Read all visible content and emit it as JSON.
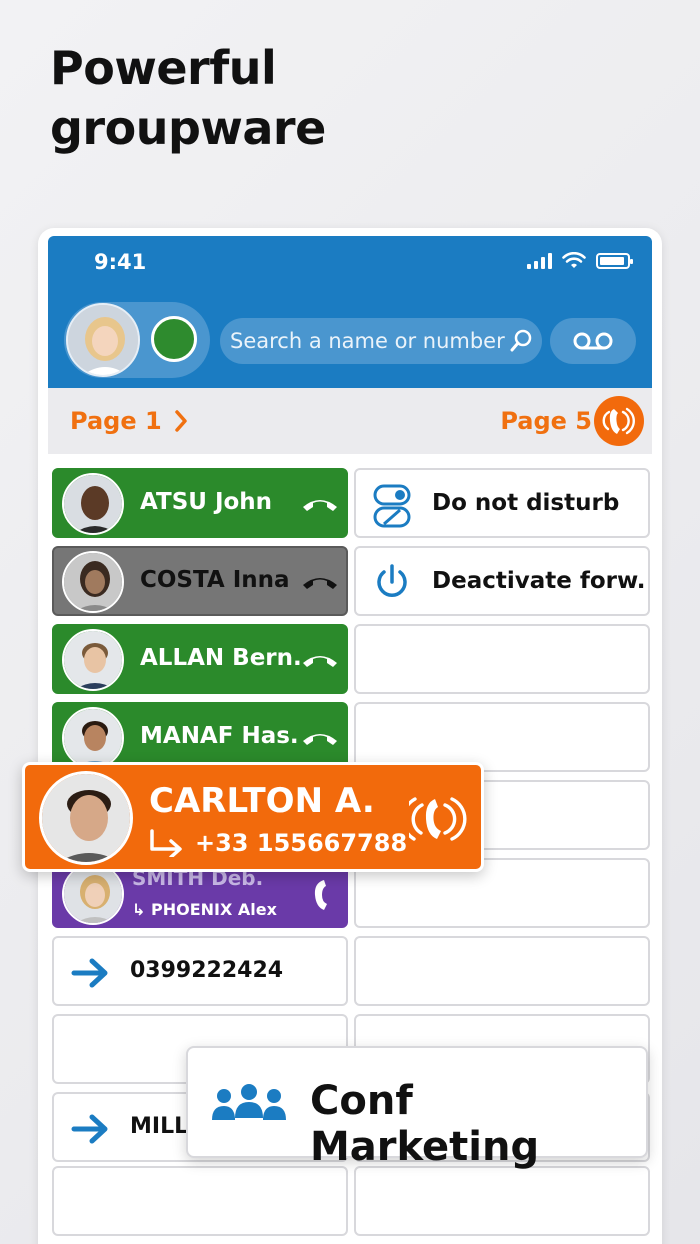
{
  "headline": {
    "line1": "Powerful",
    "line2": "groupware"
  },
  "status_bar": {
    "time": "9:41"
  },
  "header": {
    "search_placeholder": "Search a name or number"
  },
  "pages": {
    "left_label": "Page 1",
    "right_label": "Page 5"
  },
  "left_column": [
    {
      "name": "ATSU John",
      "state": "green"
    },
    {
      "name": "COSTA Inna",
      "state": "grey"
    },
    {
      "name": "ALLAN Bern.",
      "state": "green"
    },
    {
      "name": "MANAF Has.",
      "state": "green"
    },
    {
      "name": "SMITH Deb.",
      "forward": "PHOENIX Alex",
      "state": "purple"
    },
    {
      "number": "0399222424"
    },
    {
      "empty": true
    },
    {
      "number": "MILL"
    },
    {
      "empty": true
    }
  ],
  "right_column": [
    {
      "label": "Do not disturb"
    },
    {
      "label": "Deactivate forw."
    }
  ],
  "incoming_call": {
    "name": "CARLTON A.",
    "number": "+33 155667788"
  },
  "conference": {
    "label": "Conf Marketing"
  },
  "colors": {
    "blue": "#1b7cc2",
    "orange": "#f26a0c",
    "green": "#2b8a2b",
    "purple": "#6a3aa8"
  }
}
